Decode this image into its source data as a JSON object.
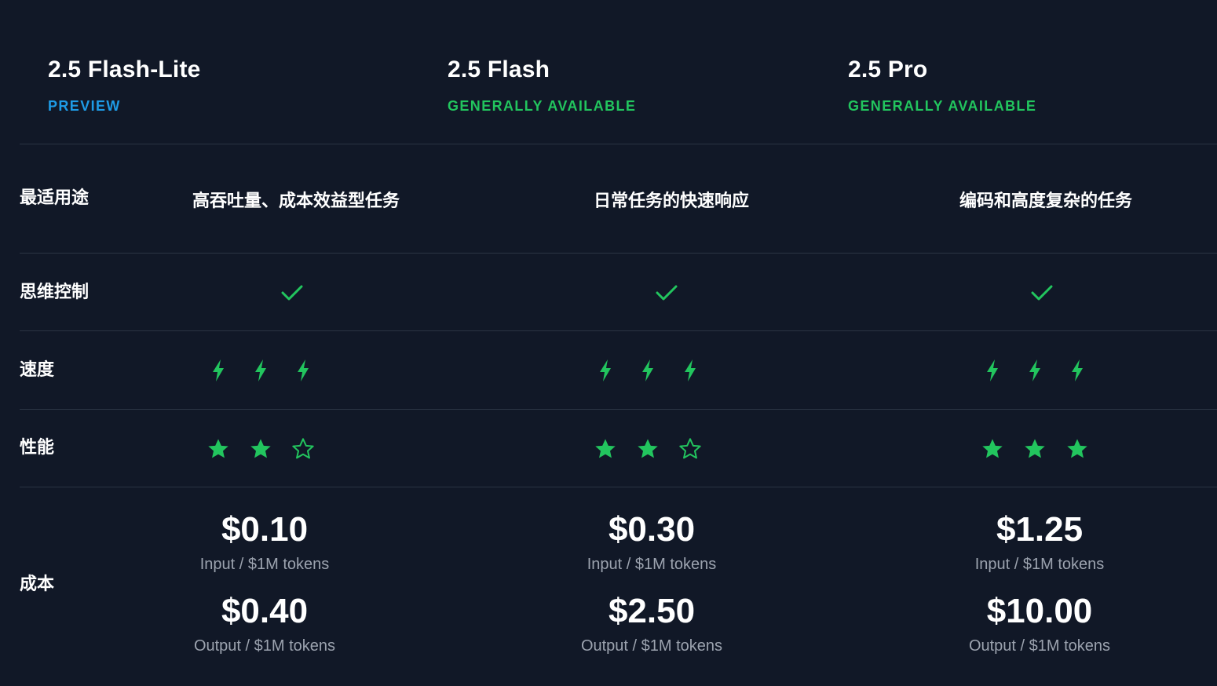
{
  "colors": {
    "background": "#111827",
    "accent_green": "#22c55e",
    "preview_blue": "#1e9be6",
    "divider": "#2b3443",
    "muted_text": "#9ca3af"
  },
  "models": [
    {
      "name": "2.5 Flash-Lite",
      "status": "PREVIEW",
      "best_use": "高吞吐量、成本效益型任务",
      "thinking_control": "check-icon",
      "speed_rating": 3,
      "performance_rating": 2,
      "input_price": "$0.10",
      "input_note": "Input / $1M tokens",
      "output_price": "$0.40",
      "output_note": "Output / $1M tokens"
    },
    {
      "name": "2.5 Flash",
      "status": "GENERALLY AVAILABLE",
      "best_use": "日常任务的快速响应",
      "thinking_control": "check-icon",
      "speed_rating": 3,
      "performance_rating": 2,
      "input_price": "$0.30",
      "input_note": "Input / $1M tokens",
      "output_price": "$2.50",
      "output_note": "Output / $1M tokens"
    },
    {
      "name": "2.5 Pro",
      "status": "GENERALLY AVAILABLE",
      "best_use": "编码和高度复杂的任务",
      "thinking_control": "check-icon",
      "speed_rating": 3,
      "performance_rating": 3,
      "input_price": "$1.25",
      "input_note": "Input / $1M tokens",
      "output_price": "$10.00",
      "output_note": "Output / $1M tokens"
    }
  ],
  "row_labels": {
    "best_use": "最适用途",
    "thinking_control": "思维控制",
    "speed": "速度",
    "performance": "性能",
    "cost": "成本"
  },
  "speed_max": 3,
  "performance_max": 3
}
